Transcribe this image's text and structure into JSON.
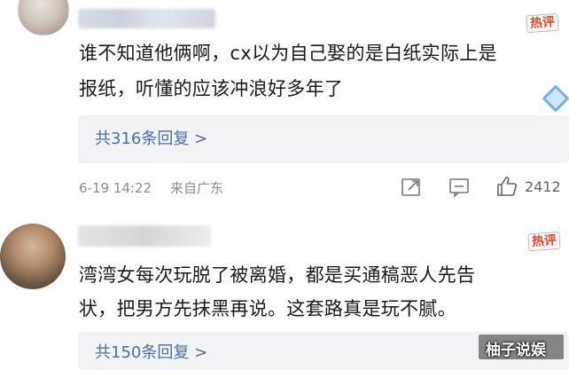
{
  "comments": [
    {
      "hot_badge": "热评",
      "text_line1": "谁不知道他俩啊，cx以为自己娶的是白纸实际上是",
      "text_line2": "报纸，听懂的应该冲浪好多年了",
      "replies_label": "共316条回复 >",
      "date": "6-19 14:22",
      "location": "来自广东",
      "likes": "2412"
    },
    {
      "hot_badge": "热评",
      "text_line1": "湾湾女每次玩脱了被离婚，都是买通稿恶人先告",
      "text_line2": "状，把男方先抹黑再说。这套路真是玩不腻。",
      "replies_label": "共150条回复 >"
    }
  ],
  "watermark": "柚子说娱",
  "icons": {
    "share": "share-icon",
    "comment": "comment-icon",
    "like": "thumbs-up-icon",
    "decoration": "diamond-icon"
  },
  "colors": {
    "hot": "#e8452c",
    "link": "#4a6fa5",
    "meta": "#8c8c8c",
    "reply_bg": "#f2f3f5"
  }
}
